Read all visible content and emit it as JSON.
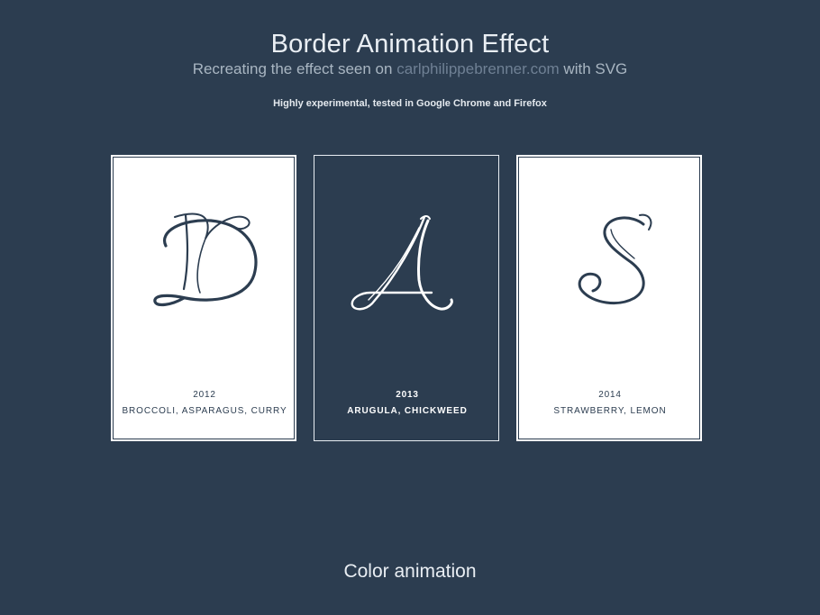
{
  "header": {
    "title": "Border Animation Effect",
    "subtitle_prefix": "Recreating the effect seen on ",
    "subtitle_link": "carlphilippebrenner.com",
    "subtitle_suffix": " with SVG",
    "note": "Highly experimental, tested in Google Chrome and Firefox"
  },
  "cards": [
    {
      "letter": "D",
      "year": "2012",
      "items": "BROCCOLI, ASPARAGUS, CURRY",
      "theme": "light"
    },
    {
      "letter": "A",
      "year": "2013",
      "items": "ARUGULA, CHICKWEED",
      "theme": "dark"
    },
    {
      "letter": "S",
      "year": "2014",
      "items": "STRAWBERRY, LEMON",
      "theme": "light"
    }
  ],
  "section": {
    "title": "Color animation"
  },
  "colors": {
    "background": "#2c3d50",
    "card_light": "#ffffff",
    "link": "#6f8094"
  }
}
